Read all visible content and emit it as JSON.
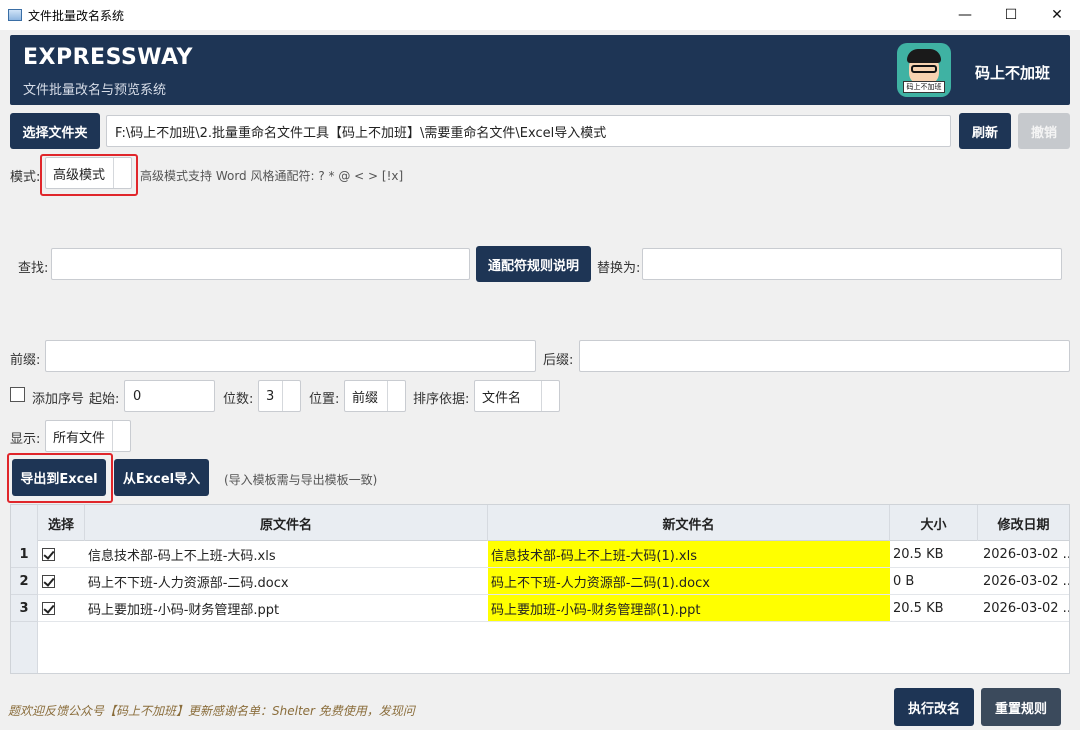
{
  "window": {
    "title": "文件批量改名系统",
    "controls": {
      "minimize": "—",
      "maximize": "☐",
      "close": "✕"
    }
  },
  "header": {
    "brand": "EXPRESSWAY",
    "subtitle": "文件批量改名与预览系统",
    "author": "码上不加班",
    "avatar_tag": "码上不加班"
  },
  "folder": {
    "select_button": "选择文件夹",
    "path": "F:\\码上不加班\\2.批量重命名文件工具【码上不加班】\\需要重命名文件\\Excel导入模式",
    "refresh_button": "刷新",
    "undo_button": "撤销"
  },
  "mode": {
    "label": "模式:",
    "value": "高级模式",
    "hint": "高级模式支持 Word 风格通配符: ? * @ < > [!x]"
  },
  "find_replace": {
    "find_label": "查找:",
    "find_value": "",
    "wildcard_button": "通配符规则说明",
    "replace_label": "替换为:",
    "replace_value": ""
  },
  "affix": {
    "prefix_label": "前缀:",
    "prefix_value": "",
    "suffix_label": "后缀:",
    "suffix_value": ""
  },
  "sequence": {
    "checkbox_label": "添加序号",
    "start_label": "起始:",
    "start_value": "0",
    "digits_label": "位数:",
    "digits_value": "3",
    "position_label": "位置:",
    "position_value": "前缀",
    "sort_label": "排序依据:",
    "sort_value": "文件名"
  },
  "display": {
    "label": "显示:",
    "value": "所有文件"
  },
  "excel": {
    "export_button": "导出到Excel",
    "import_button": "从Excel导入",
    "hint": "(导入模板需与导出模板一致)"
  },
  "table": {
    "headers": [
      "选择",
      "原文件名",
      "新文件名",
      "大小",
      "修改日期"
    ],
    "rows": [
      {
        "num": "1",
        "checked": true,
        "original": "信息技术部-码上不上班-大码.xls",
        "new": "信息技术部-码上不上班-大码(1).xls",
        "size": "20.5 KB",
        "date": "2026-03-02 ..."
      },
      {
        "num": "2",
        "checked": true,
        "original": "码上不下班-人力资源部-二码.docx",
        "new": "码上不下班-人力资源部-二码(1).docx",
        "size": "0 B",
        "date": "2026-03-02 ..."
      },
      {
        "num": "3",
        "checked": true,
        "original": "码上要加班-小码-财务管理部.ppt",
        "new": "码上要加班-小码-财务管理部(1).ppt",
        "size": "20.5 KB",
        "date": "2026-03-02 ..."
      }
    ]
  },
  "footer": {
    "text": "题欢迎反馈公众号【码上不加班】更新感谢名单：Shelter     免费使用，发现问",
    "execute_button": "执行改名",
    "reset_button": "重置规则"
  },
  "colors": {
    "primary": "#1e3555",
    "highlight": "#ffff00",
    "annotation": "#e0262b"
  }
}
